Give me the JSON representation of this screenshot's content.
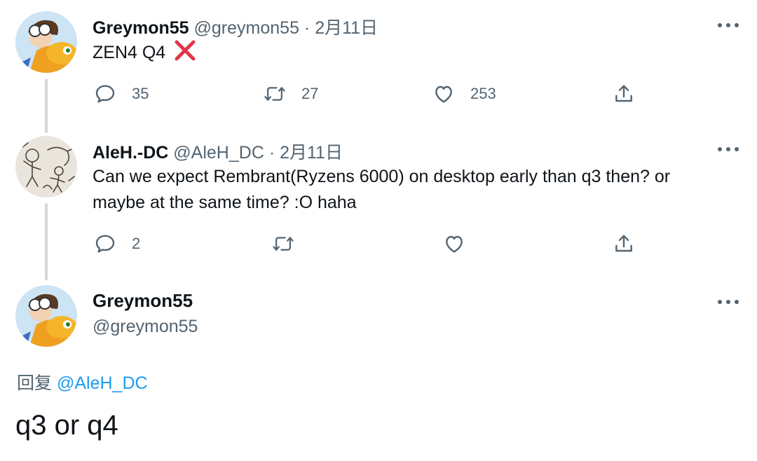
{
  "tweet1": {
    "name": "Greymon55",
    "handle": "@greymon55",
    "separator": "·",
    "date": "2月11日",
    "text": "ZEN4 Q4",
    "cross_emoji": "❌",
    "replies": "35",
    "retweets": "27",
    "likes": "253"
  },
  "tweet2": {
    "name": "AleH.-DC",
    "handle": "@AleH_DC",
    "separator": "·",
    "date": "2月11日",
    "text_line1": "Can we expect Rembrant(Ryzens 6000) on desktop early than q3 then? or",
    "text_line2": "maybe at the same time? :O haha",
    "replies": "2"
  },
  "tweet3": {
    "name": "Greymon55",
    "handle": "@greymon55",
    "reply_prefix": "回复",
    "reply_mention": "@AleH_DC",
    "text": "q3 or q4"
  },
  "colors": {
    "text": "#0f1419",
    "secondary": "#536471",
    "link": "#1d9bf0",
    "thread": "#cfd9de",
    "cross": "#e0364b"
  },
  "icons": [
    "reply-icon",
    "retweet-icon",
    "like-icon",
    "share-icon",
    "more-icon",
    "cross-icon"
  ]
}
